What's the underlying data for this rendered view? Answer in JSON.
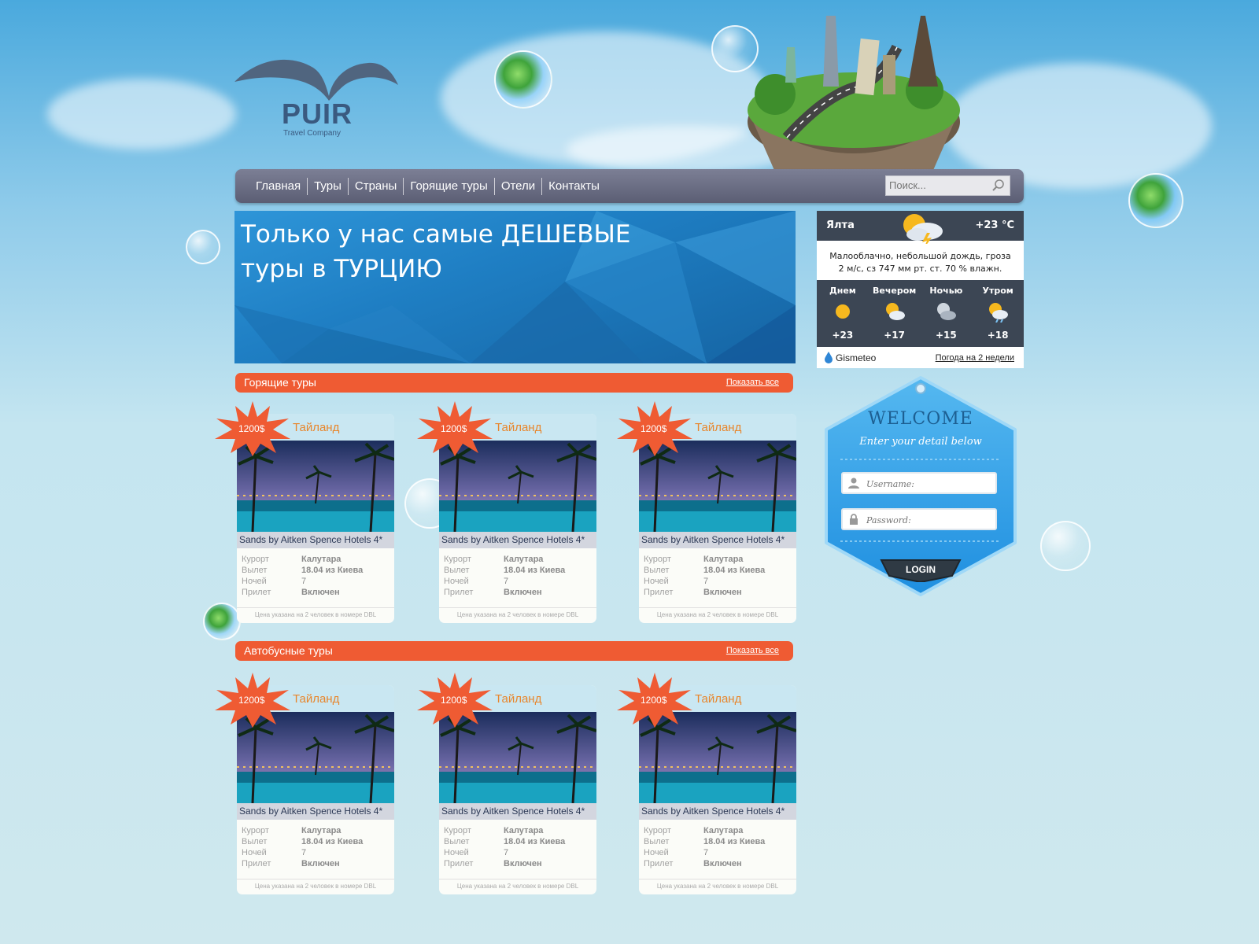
{
  "logo": {
    "name": "PUIR",
    "tagline": "Travel Company"
  },
  "nav": {
    "items": [
      "Главная",
      "Туры",
      "Страны",
      "Горящие туры",
      "Отели",
      "Контакты"
    ],
    "search_placeholder": "Поиск..."
  },
  "banner": {
    "line1": "Только у нас самые ДЕШЕВЫЕ",
    "line2": "туры в ТУРЦИЮ"
  },
  "sections": [
    {
      "title": "Горящие туры",
      "more": "Показать все"
    },
    {
      "title": "Автобусные туры",
      "more": "Показать все"
    }
  ],
  "card": {
    "price": "1200$",
    "country": "Тайланд",
    "hotel": "Sands by Aitken Spence Hotels 4*",
    "fields": [
      {
        "k": "Курорт",
        "v": "Калутара"
      },
      {
        "k": "Вылет",
        "v": "18.04 из Киева"
      },
      {
        "k": "Ночей",
        "v": "7"
      },
      {
        "k": "Прилет",
        "v": "Включен"
      }
    ],
    "note": "Цена указана на 2 человек в номере DBL"
  },
  "weather": {
    "city": "Ялта",
    "temp": "+23 °C",
    "desc_line1": "Малооблачно, небольшой дождь, гроза",
    "desc_line2": "2 м/с, сз  747 мм рт. ст.  70 % влажн.",
    "periods": [
      {
        "label": "Днем",
        "temp": "+23",
        "icon": "sun-icon"
      },
      {
        "label": "Вечером",
        "temp": "+17",
        "icon": "sun-cloud-icon"
      },
      {
        "label": "Ночью",
        "temp": "+15",
        "icon": "moon-cloud-icon"
      },
      {
        "label": "Утром",
        "temp": "+18",
        "icon": "sun-rain-icon"
      }
    ],
    "brand": "Gismeteo",
    "link": "Погода на 2 недели"
  },
  "login": {
    "title": "WELCOME",
    "subtitle": "Enter your detail below",
    "username_placeholder": "Username:",
    "password_placeholder": "Password:",
    "button": "LOGIN"
  },
  "colors": {
    "accent": "#ef5b33",
    "nav": "#646880",
    "banner": "#1f7fc4",
    "login": "#2f9ee6"
  }
}
